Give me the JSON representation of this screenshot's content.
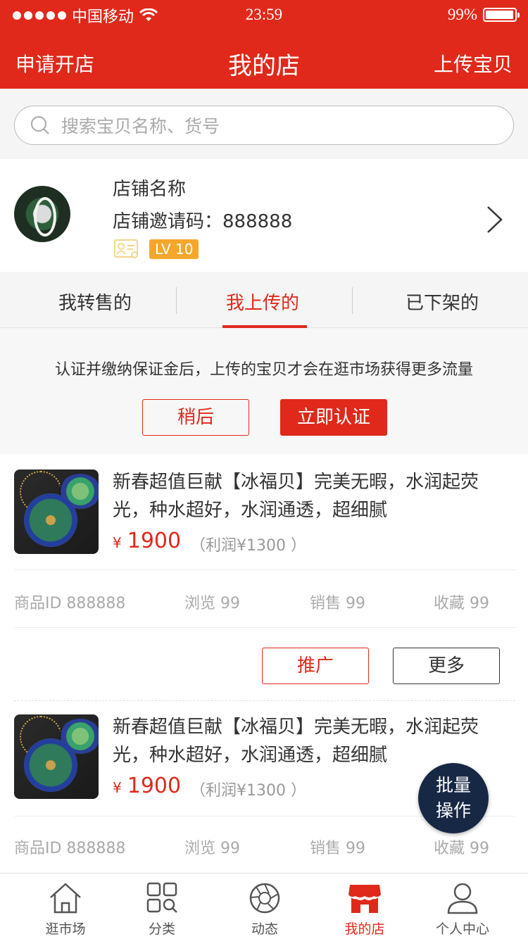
{
  "status_bar": {
    "carrier": "中国移动",
    "time": "23:59",
    "battery": "99%"
  },
  "nav": {
    "left": "申请开店",
    "title": "我的店",
    "right": "上传宝贝"
  },
  "search": {
    "placeholder": "搜索宝贝名称、货号"
  },
  "shop": {
    "name": "店铺名称",
    "invite_label": "店铺邀请码：",
    "invite_code": "888888",
    "level": "LV 10"
  },
  "tabs": [
    {
      "label": "我转售的",
      "active": false
    },
    {
      "label": "我上传的",
      "active": true
    },
    {
      "label": "已下架的",
      "active": false
    }
  ],
  "notice": {
    "text": "认证并缴纳保证金后，上传的宝贝才会在逛市场获得更多流量",
    "later": "稍后",
    "verify": "立即认证"
  },
  "products": [
    {
      "title": "新春超值巨献【冰福贝】完美无暇，水润起荧光，种水超好，水润通透，超细腻",
      "currency": "¥",
      "price": "1900",
      "profit": "（利润¥1300 ）",
      "id_label": "商品ID 888888",
      "views": "浏览 99",
      "sales": "销售 99",
      "favs": "收藏 99",
      "promote": "推广",
      "more": "更多"
    },
    {
      "title": "新春超值巨献【冰福贝】完美无暇，水润起荧光，种水超好，水润通透，超细腻",
      "currency": "¥",
      "price": "1900",
      "profit": "（利润¥1300 ）",
      "id_label": "商品ID 888888",
      "views": "浏览 99",
      "sales": "销售 99",
      "favs": "收藏 99"
    }
  ],
  "batch_button": {
    "line1": "批量",
    "line2": "操作"
  },
  "tabbar": [
    {
      "label": "逛市场",
      "icon": "home-icon",
      "active": false
    },
    {
      "label": "分类",
      "icon": "category-icon",
      "active": false
    },
    {
      "label": "动态",
      "icon": "aperture-icon",
      "active": false
    },
    {
      "label": "我的店",
      "icon": "shop-icon",
      "active": true
    },
    {
      "label": "个人中心",
      "icon": "user-icon",
      "active": false
    }
  ],
  "colors": {
    "brand": "#e0291a",
    "level_badge": "#f4a72b",
    "batch_button": "#172845"
  }
}
